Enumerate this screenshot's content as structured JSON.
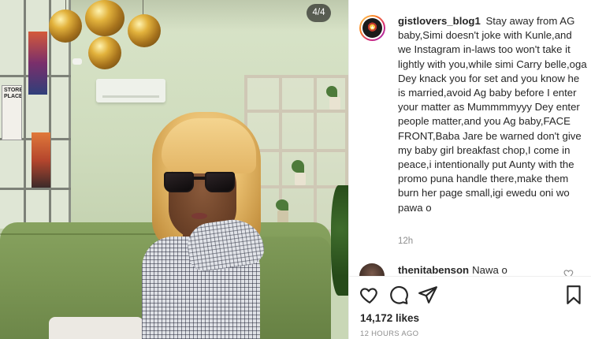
{
  "photo": {
    "counter": "4/4",
    "wall_sign_text": "STORE PLACE"
  },
  "post": {
    "author": {
      "username": "gistlovers_blog1",
      "avatar_icon": "profile-avatar-icon"
    },
    "caption": "Stay away from AG baby,Simi doesn't joke with Kunle,and we Instagram in-laws too won't take it lightly with you,while simi Carry belle,oga Dey knack you for set and you know he is married,avoid Ag baby before I enter your matter as Mummmmyyy Dey enter people matter,and you Ag baby,FACE FRONT,Baba Jare be warned don't give my baby girl breakfast chop,I come in peace,i intentionally put Aunty with the promo puna handle there,make them burn her page small,igi ewedu oni wo pawa o",
    "caption_time": "12h",
    "likes": "14,172 likes",
    "posted_ago": "12 HOURS AGO"
  },
  "comments": [
    {
      "username": "thenitabenson",
      "text": "Nawa o"
    }
  ],
  "actions": {
    "like_icon": "heart-icon",
    "comment_icon": "comment-icon",
    "share_icon": "share-icon",
    "save_icon": "bookmark-icon"
  },
  "colors": {
    "text_primary": "#262626",
    "text_secondary": "#8e8e8e",
    "border": "#efefef"
  }
}
